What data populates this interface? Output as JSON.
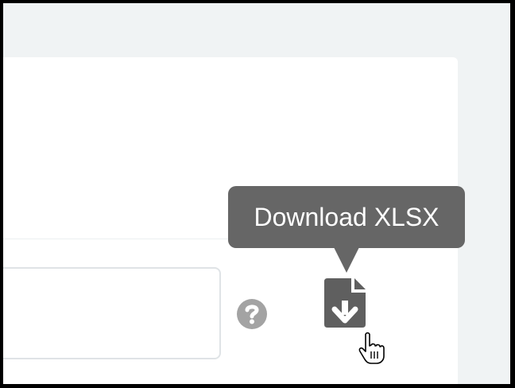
{
  "tooltip": {
    "text": "Download XLSX"
  },
  "icons": {
    "help": "question-circle-icon",
    "download": "file-download-icon",
    "cursor": "hand-pointer-icon"
  },
  "colors": {
    "tooltip_bg": "#666666",
    "icon_gray": "#a3a3a3",
    "file_icon": "#5f5f5f",
    "page_bg": "#f0f3f4"
  }
}
